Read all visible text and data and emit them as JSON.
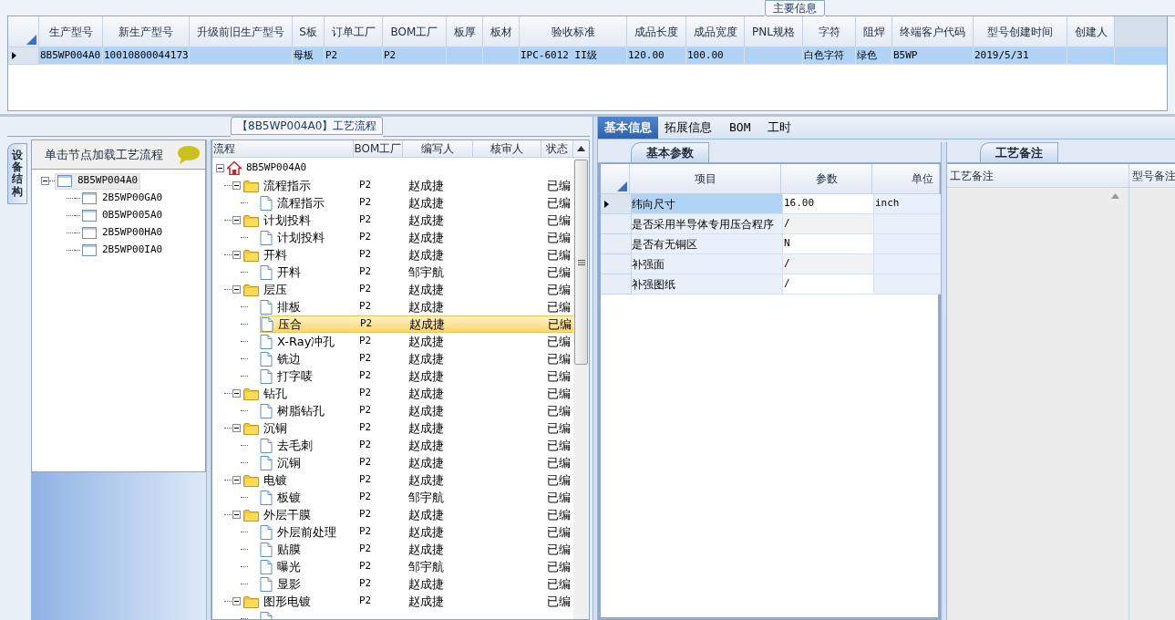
{
  "main_info": {
    "title": "主要信息",
    "columns": [
      "生产型号",
      "新生产型号",
      "升级前旧生产型号",
      "S板",
      "订单工厂",
      "BOM工厂",
      "板厚",
      "板材",
      "验收标准",
      "成品长度",
      "成品宽度",
      "PNL规格",
      "字符",
      "阻焊",
      "终端客户代码",
      "型号创建时间",
      "创建人"
    ],
    "rows": [
      {
        "selected": true,
        "cells": [
          "8B5WP004A0",
          "10010800044173",
          "",
          "母板",
          "P2",
          "P2",
          "",
          "",
          "IPC-6012 II级",
          "120.00",
          "100.00",
          "",
          "白色字符",
          "绿色",
          "B5WP",
          "2019/5/31",
          ""
        ]
      }
    ]
  },
  "process_panel": {
    "title": "【8B5WP004A0】工艺流程",
    "side_tab": "设备结构",
    "structure_tree": {
      "hint": "单击节点加载工艺流程",
      "nodes": [
        {
          "label": "8B5WP004A0",
          "selected": true,
          "expanded": true,
          "children": [
            {
              "label": "2B5WP00GA0",
              "selected": false
            },
            {
              "label": "0B5WP005A0",
              "selected": false
            },
            {
              "label": "2B5WP00HA0",
              "selected": false
            },
            {
              "label": "2B5WP00IA0",
              "selected": false
            }
          ]
        }
      ]
    },
    "flow_tree": {
      "columns": [
        "流程",
        "BOM工厂",
        "编写人",
        "核审人",
        "状态"
      ],
      "nodes": [
        {
          "kind": "root",
          "label": "8B5WP004A0",
          "expanded": true,
          "selected": false,
          "children": [
            {
              "kind": "folder",
              "label": "流程指示",
              "bom": "P2",
              "author": "赵成捷",
              "status": "已编",
              "expanded": true,
              "selected": false,
              "children": [
                {
                  "kind": "step",
                  "label": "流程指示",
                  "bom": "P2",
                  "author": "赵成捷",
                  "status": "已编",
                  "selected": false
                }
              ]
            },
            {
              "kind": "folder",
              "label": "计划投料",
              "bom": "P2",
              "author": "赵成捷",
              "status": "已编",
              "expanded": true,
              "selected": false,
              "children": [
                {
                  "kind": "step",
                  "label": "计划投料",
                  "bom": "P2",
                  "author": "赵成捷",
                  "status": "已编",
                  "selected": false
                }
              ]
            },
            {
              "kind": "folder",
              "label": "开料",
              "bom": "P2",
              "author": "赵成捷",
              "status": "已编",
              "expanded": true,
              "selected": false,
              "children": [
                {
                  "kind": "step",
                  "label": "开料",
                  "bom": "P2",
                  "author": "邹宇航",
                  "status": "已编",
                  "selected": false
                }
              ]
            },
            {
              "kind": "folder",
              "label": "层压",
              "bom": "P2",
              "author": "赵成捷",
              "status": "已编",
              "expanded": true,
              "selected": false,
              "children": [
                {
                  "kind": "step",
                  "label": "排板",
                  "bom": "P2",
                  "author": "赵成捷",
                  "status": "已编",
                  "selected": false
                },
                {
                  "kind": "step",
                  "label": "压合",
                  "bom": "P2",
                  "author": "赵成捷",
                  "status": "已编",
                  "selected": true
                },
                {
                  "kind": "step",
                  "label": "X-Ray冲孔",
                  "bom": "P2",
                  "author": "赵成捷",
                  "status": "已编",
                  "selected": false
                },
                {
                  "kind": "step",
                  "label": "铣边",
                  "bom": "P2",
                  "author": "赵成捷",
                  "status": "已编",
                  "selected": false
                },
                {
                  "kind": "step",
                  "label": "打字唛",
                  "bom": "P2",
                  "author": "赵成捷",
                  "status": "已编",
                  "selected": false
                }
              ]
            },
            {
              "kind": "folder",
              "label": "钻孔",
              "bom": "P2",
              "author": "赵成捷",
              "status": "已编",
              "expanded": true,
              "selected": false,
              "children": [
                {
                  "kind": "step",
                  "label": "树脂钻孔",
                  "bom": "P2",
                  "author": "赵成捷",
                  "status": "已编",
                  "selected": false
                }
              ]
            },
            {
              "kind": "folder",
              "label": "沉铜",
              "bom": "P2",
              "author": "赵成捷",
              "status": "已编",
              "expanded": true,
              "selected": false,
              "children": [
                {
                  "kind": "step",
                  "label": "去毛刺",
                  "bom": "P2",
                  "author": "赵成捷",
                  "status": "已编",
                  "selected": false
                },
                {
                  "kind": "step",
                  "label": "沉铜",
                  "bom": "P2",
                  "author": "赵成捷",
                  "status": "已编",
                  "selected": false
                }
              ]
            },
            {
              "kind": "folder",
              "label": "电镀",
              "bom": "P2",
              "author": "赵成捷",
              "status": "已编",
              "expanded": true,
              "selected": false,
              "children": [
                {
                  "kind": "step",
                  "label": "板镀",
                  "bom": "P2",
                  "author": "邹宇航",
                  "status": "已编",
                  "selected": false
                }
              ]
            },
            {
              "kind": "folder",
              "label": "外层干膜",
              "bom": "P2",
              "author": "赵成捷",
              "status": "已编",
              "expanded": true,
              "selected": false,
              "children": [
                {
                  "kind": "step",
                  "label": "外层前处理",
                  "bom": "P2",
                  "author": "赵成捷",
                  "status": "已编",
                  "selected": false
                },
                {
                  "kind": "step",
                  "label": "贴膜",
                  "bom": "P2",
                  "author": "赵成捷",
                  "status": "已编",
                  "selected": false
                },
                {
                  "kind": "step",
                  "label": "曝光",
                  "bom": "P2",
                  "author": "邹宇航",
                  "status": "已编",
                  "selected": false
                },
                {
                  "kind": "step",
                  "label": "显影",
                  "bom": "P2",
                  "author": "赵成捷",
                  "status": "已编",
                  "selected": false
                }
              ]
            },
            {
              "kind": "folder",
              "label": "图形电镀",
              "bom": "P2",
              "author": "赵成捷",
              "status": "已编",
              "expanded": true,
              "selected": false,
              "children": [
                {
                  "kind": "step",
                  "selected": false
                }
              ]
            }
          ]
        }
      ]
    }
  },
  "detail_tabs": [
    {
      "label": "基本信息",
      "selected": true
    },
    {
      "label": "拓展信息",
      "selected": false
    },
    {
      "label": "BOM",
      "selected": false
    },
    {
      "label": "工时",
      "selected": false
    }
  ],
  "basic_params": {
    "tab": "基本参数",
    "columns": [
      "项目",
      "参数",
      "单位"
    ],
    "rows": [
      {
        "item": "纬向尺寸",
        "value": "16.00",
        "unit": "inch",
        "selected": true
      },
      {
        "item": "是否采用半导体专用压合程序",
        "value": "/",
        "selected": false
      },
      {
        "item": "是否有无铜区",
        "value": "N",
        "selected": false
      },
      {
        "item": "补强面",
        "value": "/",
        "selected": false
      },
      {
        "item": "补强图纸",
        "value": "/",
        "selected": false
      }
    ]
  },
  "remarks": {
    "tab": "工艺备注",
    "columns": [
      "工艺备注",
      "型号备注"
    ]
  }
}
